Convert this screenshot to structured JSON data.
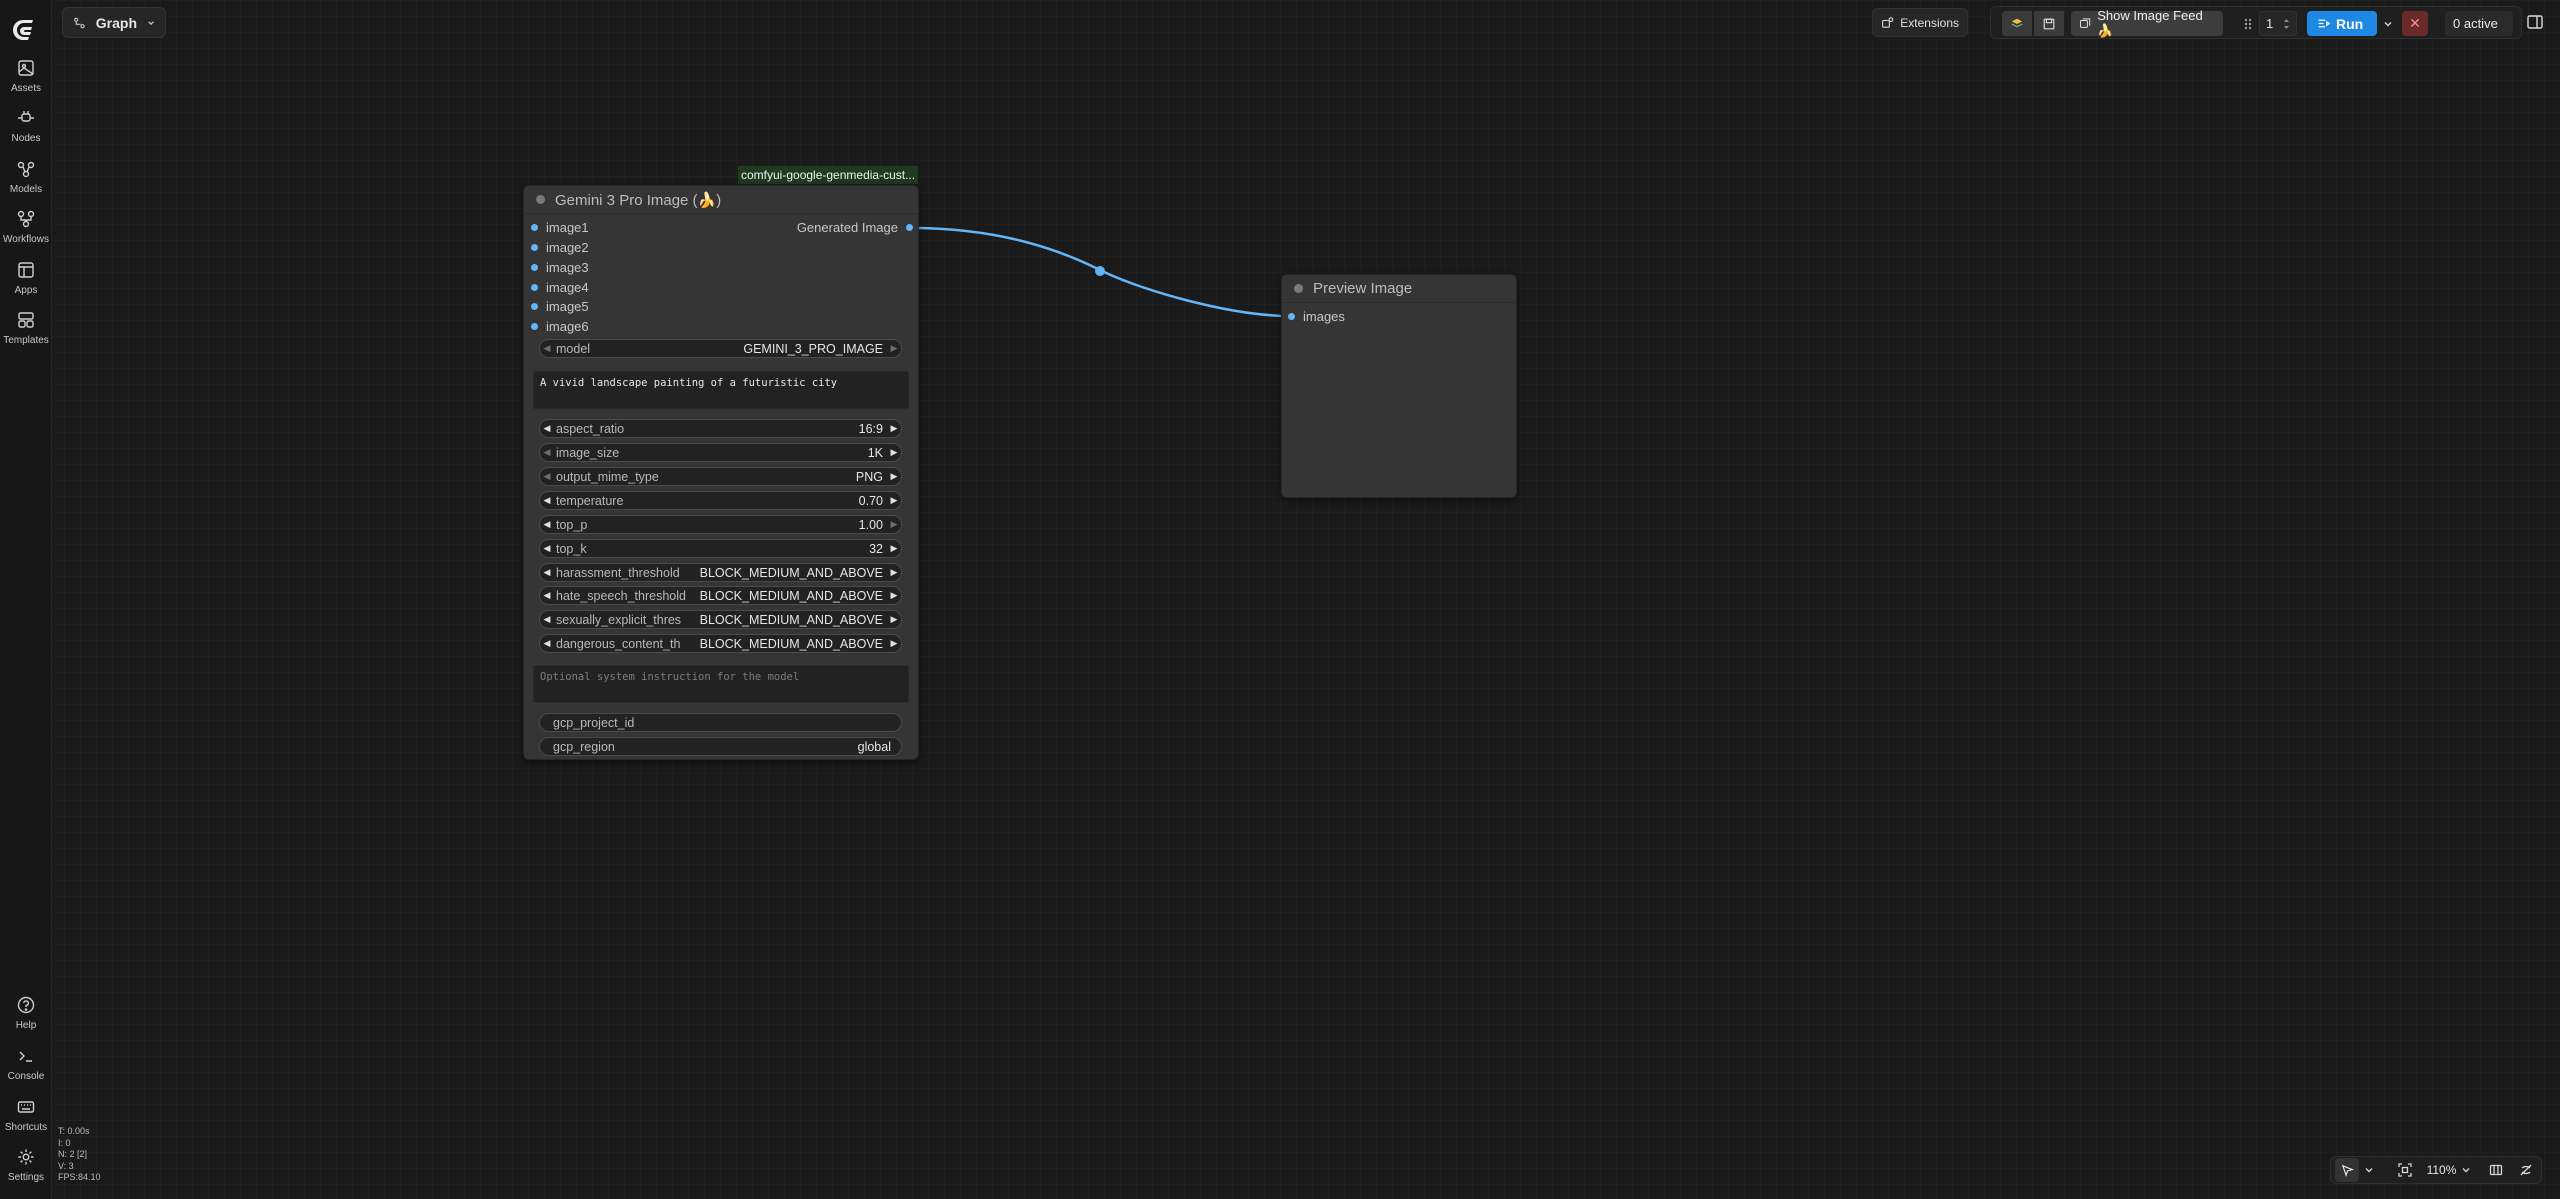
{
  "sidebar": {
    "items": [
      {
        "label": "Assets",
        "icon": "image-icon"
      },
      {
        "label": "Nodes",
        "icon": "plug-icon"
      },
      {
        "label": "Models",
        "icon": "cube-icon"
      },
      {
        "label": "Workflows",
        "icon": "workflow-icon"
      },
      {
        "label": "Apps",
        "icon": "app-window-icon"
      },
      {
        "label": "Templates",
        "icon": "template-icon"
      }
    ],
    "bottom_items": [
      {
        "label": "Help",
        "icon": "help-circle-icon"
      },
      {
        "label": "Console",
        "icon": "terminal-icon"
      },
      {
        "label": "Shortcuts",
        "icon": "keyboard-icon"
      },
      {
        "label": "Settings",
        "icon": "gear-icon"
      }
    ]
  },
  "header": {
    "graph_label": "Graph"
  },
  "toolbar": {
    "extensions_label": "Extensions",
    "show_image_feed_label": "Show Image Feed 🍌",
    "queue_count": "1",
    "run_label": "Run",
    "stop_glyph": "✕",
    "active_label": "0 active"
  },
  "gemini_node": {
    "badge": "comfyui-google-genmedia-cust...",
    "title": "Gemini 3 Pro Image (🍌)",
    "inputs": [
      "image1",
      "image2",
      "image3",
      "image4",
      "image5",
      "image6"
    ],
    "output": "Generated Image",
    "widgets": {
      "model": {
        "name": "model",
        "value": "GEMINI_3_PRO_IMAGE"
      },
      "prompt": "A vivid landscape painting of a futuristic city",
      "aspect_ratio": {
        "name": "aspect_ratio",
        "value": "16:9"
      },
      "image_size": {
        "name": "image_size",
        "value": "1K"
      },
      "output_mime_type": {
        "name": "output_mime_type",
        "value": "PNG"
      },
      "temperature": {
        "name": "temperature",
        "value": "0.70"
      },
      "top_p": {
        "name": "top_p",
        "value": "1.00"
      },
      "top_k": {
        "name": "top_k",
        "value": "32"
      },
      "harassment_threshold": {
        "name": "harassment_threshold",
        "value": "BLOCK_MEDIUM_AND_ABOVE"
      },
      "hate_speech_threshold": {
        "name": "hate_speech_threshold",
        "value": "BLOCK_MEDIUM_AND_ABOVE"
      },
      "sexually_explicit_threshold": {
        "name": "sexually_explicit_thres",
        "value": "BLOCK_MEDIUM_AND_ABOVE"
      },
      "dangerous_content_threshold": {
        "name": "dangerous_content_th",
        "value": "BLOCK_MEDIUM_AND_ABOVE"
      },
      "system_instruction_placeholder": "Optional system instruction for the model",
      "gcp_project_id": {
        "name": "gcp_project_id",
        "value": ""
      },
      "gcp_region": {
        "name": "gcp_region",
        "value": "global"
      }
    }
  },
  "preview_node": {
    "title": "Preview Image",
    "input": "images"
  },
  "status": {
    "t": "T: 0.00s",
    "i": "I: 0",
    "n": "N: 2 [2]",
    "v": "V: 3",
    "fps": "FPS:84.10"
  },
  "bottom_controls": {
    "zoom": "110%"
  },
  "colors": {
    "link": "#64b5f6",
    "run_button": "#1e88e5",
    "node_body": "#353535",
    "canvas": "#1a1a1a"
  }
}
